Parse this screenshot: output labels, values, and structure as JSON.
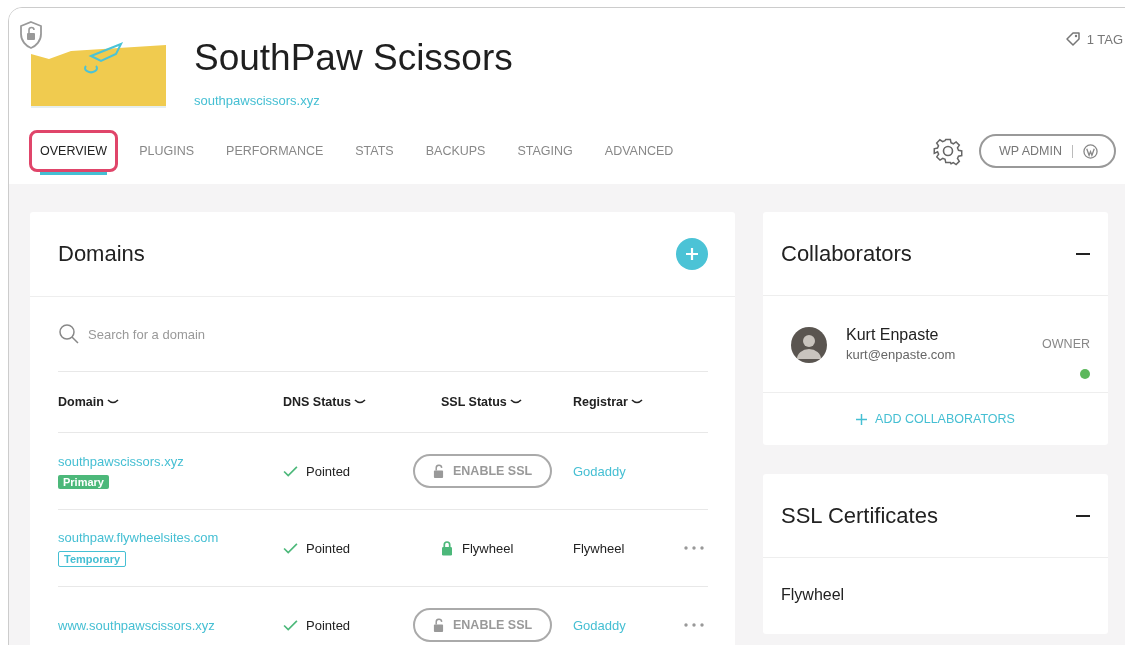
{
  "site": {
    "title": "SouthPaw Scissors",
    "url": "southpawscissors.xyz",
    "tags": "1 TAG"
  },
  "tabs": [
    {
      "label": "OVERVIEW",
      "selected": true,
      "highlighted": true
    },
    {
      "label": "PLUGINS",
      "selected": false,
      "highlighted": false
    },
    {
      "label": "PERFORMANCE",
      "selected": false,
      "highlighted": false
    },
    {
      "label": "STATS",
      "selected": false,
      "highlighted": false
    },
    {
      "label": "BACKUPS",
      "selected": false,
      "highlighted": false
    },
    {
      "label": "STAGING",
      "selected": false,
      "highlighted": false
    },
    {
      "label": "ADVANCED",
      "selected": false,
      "highlighted": false
    }
  ],
  "wp_admin": "WP ADMIN",
  "domains": {
    "title": "Domains",
    "search_placeholder": "Search for a domain",
    "columns": [
      "Domain",
      "DNS Status",
      "SSL Status",
      "Registrar"
    ],
    "rows": [
      {
        "domain": "southpawscissors.xyz",
        "badge": {
          "label": "Primary",
          "kind": "primary"
        },
        "dns": "Pointed",
        "ssl": {
          "kind": "button",
          "label": "ENABLE SSL"
        },
        "registrar": {
          "label": "Godaddy",
          "link": true
        },
        "menu": false
      },
      {
        "domain": "southpaw.flywheelsites.com",
        "badge": {
          "label": "Temporary",
          "kind": "temporary"
        },
        "dns": "Pointed",
        "ssl": {
          "kind": "secured",
          "label": "Flywheel"
        },
        "registrar": {
          "label": "Flywheel",
          "link": false
        },
        "menu": true
      },
      {
        "domain": "www.southpawscissors.xyz",
        "dns": "Pointed",
        "ssl": {
          "kind": "button",
          "label": "ENABLE SSL"
        },
        "registrar": {
          "label": "Godaddy",
          "link": true
        },
        "menu": true
      }
    ]
  },
  "collaborators": {
    "title": "Collaborators",
    "people": [
      {
        "name": "Kurt Enpaste",
        "email": "kurt@enpaste.com",
        "role": "OWNER",
        "color": "#5cb85c"
      }
    ],
    "add_label": "ADD COLLABORATORS"
  },
  "ssl_certificates": {
    "title": "SSL Certificates",
    "items": [
      "Flywheel"
    ]
  }
}
